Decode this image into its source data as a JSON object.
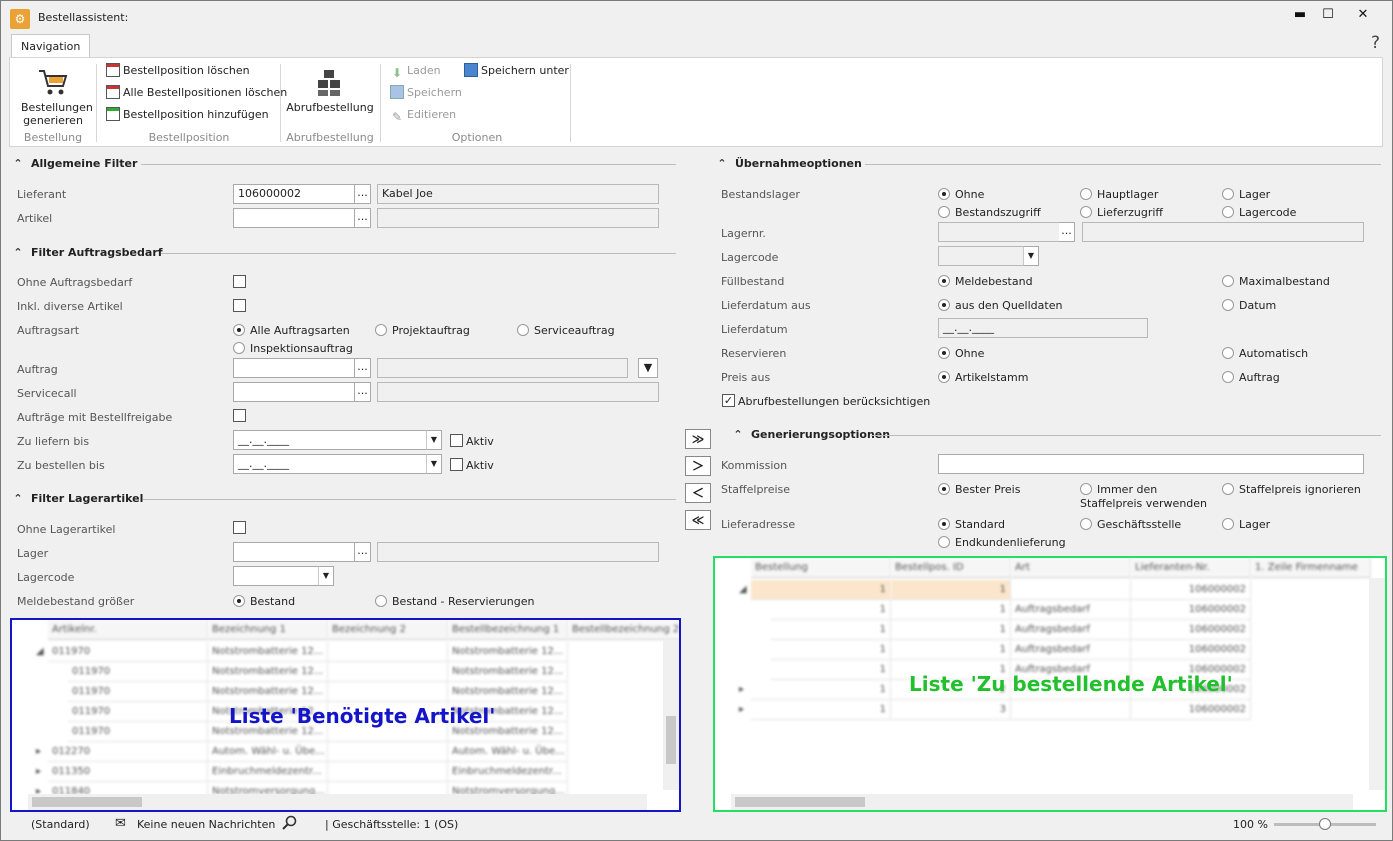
{
  "window": {
    "title": "Bestellassistent:",
    "minimize": "▬",
    "maximize": "☐",
    "close": "✕",
    "help": "?"
  },
  "ribbon": {
    "tab": "Navigation",
    "bestellung": {
      "button": "Bestellungen generieren",
      "group": "Bestellung"
    },
    "bestellposition": {
      "items": [
        "Bestellposition löschen",
        "Alle Bestellpositionen löschen",
        "Bestellposition hinzufügen"
      ],
      "group": "Bestellposition"
    },
    "abrufbestellung": {
      "button": "Abrufbestellung",
      "group": "Abrufbestellung"
    },
    "optionen": {
      "laden": "Laden",
      "speichern": "Speichern",
      "editieren": "Editieren",
      "speichern_unter": "Speichern unter",
      "group": "Optionen"
    }
  },
  "left": {
    "allgemeine": {
      "title": "Allgemeine Filter",
      "lieferant_label": "Lieferant",
      "lieferant_value": "106000002",
      "lieferant_name": "Kabel Joe",
      "artikel_label": "Artikel"
    },
    "auftragsbedarf": {
      "title": "Filter Auftragsbedarf",
      "ohne": "Ohne Auftragsbedarf",
      "inkl": "Inkl. diverse Artikel",
      "auftragsart_label": "Auftragsart",
      "auftragsarten": [
        "Alle Auftragsarten",
        "Projektauftrag",
        "Serviceauftrag",
        "Inspektionsauftrag"
      ],
      "auftrag": "Auftrag",
      "servicecall": "Servicecall",
      "freigabe": "Aufträge mit Bestellfreigabe",
      "zu_liefern": "Zu liefern bis",
      "zu_bestellen": "Zu bestellen bis",
      "date_placeholder": "__.__.____",
      "aktiv": "Aktiv"
    },
    "lagerartikel": {
      "title": "Filter Lagerartikel",
      "ohne": "Ohne Lagerartikel",
      "lager": "Lager",
      "lagercode": "Lagercode",
      "meldebestand": "Meldebestand größer",
      "opt1": "Bestand",
      "opt2": "Bestand - Reservierungen"
    }
  },
  "right": {
    "uebernahme": {
      "title": "Übernahmeoptionen",
      "bestandslager": "Bestandslager",
      "bl_opts": [
        "Ohne",
        "Hauptlager",
        "Lager",
        "Bestandszugriff",
        "Lieferzugriff",
        "Lagercode"
      ],
      "lagernr": "Lagernr.",
      "lagercode": "Lagercode",
      "fuellbestand": "Füllbestand",
      "fb_opts": [
        "Meldebestand",
        "Maximalbestand"
      ],
      "lieferdatum_aus": "Lieferdatum aus",
      "la_opts": [
        "aus den Quelldaten",
        "Datum"
      ],
      "lieferdatum": "Lieferdatum",
      "lieferdatum_value": "__.__.____",
      "reservieren": "Reservieren",
      "res_opts": [
        "Ohne",
        "Automatisch"
      ],
      "preis_aus": "Preis aus",
      "preis_opts": [
        "Artikelstamm",
        "Auftrag"
      ],
      "abruf": "Abrufbestellungen berücksichtigen"
    },
    "generierung": {
      "title": "Generierungsoptionen",
      "kommission": "Kommission",
      "staffelpreise": "Staffelpreise",
      "sp_opts": [
        "Bester Preis",
        "Immer den Staffelpreis verwenden",
        "Staffelpreis ignorieren"
      ],
      "lieferadresse": "Lieferadresse",
      "la_opts": [
        "Standard",
        "Geschäftsstelle",
        "Lager",
        "Endkundenlieferung"
      ]
    }
  },
  "transfer": [
    "≫",
    "＞",
    "＜",
    "≪"
  ],
  "left_grid": {
    "columns": [
      "Artikelnr.",
      "Bezeichnung 1",
      "Bezeichnung 2",
      "Bestellbezeichnung 1",
      "Bestellbezeichnung 2"
    ],
    "rows": [
      [
        "◢",
        "011970",
        "Notstrombatterie 12...",
        "",
        "Notstrombatterie 12..."
      ],
      [
        "",
        "011970",
        "Notstrombatterie 12...",
        "",
        "Notstrombatterie 12..."
      ],
      [
        "",
        "011970",
        "Notstrombatterie 12...",
        "",
        "Notstrombatterie 12..."
      ],
      [
        "",
        "011970",
        "Notstrombatterie 12...",
        "",
        "Notstrombatterie 12..."
      ],
      [
        "",
        "011970",
        "Notstrombatterie 12...",
        "",
        "Notstrombatterie 12..."
      ],
      [
        "▸",
        "012270",
        "Autom. Wähl- u. Übe...",
        "",
        "Autom. Wähl- u. Übe..."
      ],
      [
        "▸",
        "011350",
        "Einbruchmeldezentr...",
        "",
        "Einbruchmeldezentr..."
      ],
      [
        "▸",
        "011840",
        "Notstromversorgung...",
        "",
        "Notstromversorgung..."
      ]
    ],
    "overlay": "Liste 'Benötigte Artikel'",
    "overlay_color": "#1414c8"
  },
  "right_grid": {
    "columns": [
      "Bestellung",
      "Bestellpos. ID",
      "Art",
      "Lieferanten-Nr.",
      "1. Zeile Firmenname"
    ],
    "rows": [
      [
        "◢",
        "1",
        "1",
        "",
        "106000002"
      ],
      [
        "",
        "1",
        "1",
        "Auftragsbedarf",
        "106000002"
      ],
      [
        "",
        "1",
        "1",
        "Auftragsbedarf",
        "106000002"
      ],
      [
        "",
        "1",
        "1",
        "Auftragsbedarf",
        "106000002"
      ],
      [
        "",
        "1",
        "1",
        "Auftragsbedarf",
        "106000002"
      ],
      [
        "▸",
        "1",
        "2",
        "",
        "106000002"
      ],
      [
        "▸",
        "1",
        "3",
        "",
        "106000002"
      ]
    ],
    "overlay": "Liste 'Zu bestellende Artikel'",
    "overlay_color": "#22c02c"
  },
  "status": {
    "standard": "(Standard)",
    "messages": "Keine neuen Nachrichten",
    "branch": "| Geschäftsstelle:  1 (OS)",
    "zoom": "100 %",
    "zoom_level": 0.5
  }
}
